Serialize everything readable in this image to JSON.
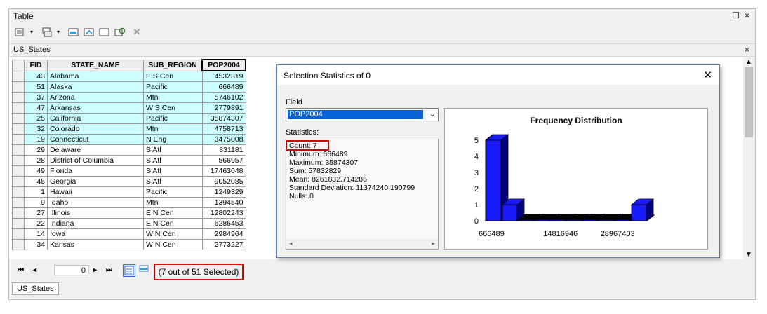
{
  "window": {
    "title": "Table",
    "restore_glyph": "☐",
    "close_glyph": "×"
  },
  "toolbar": {
    "icons": [
      "table-options-icon",
      "related-tables-icon",
      "select-by-attributes-icon",
      "switch-selection-icon",
      "clear-selection-icon",
      "zoom-to-selected-icon",
      "delete-selected-icon"
    ]
  },
  "table_tab_title": "US_States",
  "table": {
    "headers": [
      "FID",
      "STATE_NAME",
      "SUB_REGION",
      "POP2004"
    ],
    "rows": [
      {
        "fid": "43",
        "state": "Alabama",
        "region": "E S Cen",
        "pop": "4532319",
        "selected": true
      },
      {
        "fid": "51",
        "state": "Alaska",
        "region": "Pacific",
        "pop": "666489",
        "selected": true
      },
      {
        "fid": "37",
        "state": "Arizona",
        "region": "Mtn",
        "pop": "5746102",
        "selected": true
      },
      {
        "fid": "47",
        "state": "Arkansas",
        "region": "W S Cen",
        "pop": "2779891",
        "selected": true
      },
      {
        "fid": "25",
        "state": "California",
        "region": "Pacific",
        "pop": "35874307",
        "selected": true
      },
      {
        "fid": "32",
        "state": "Colorado",
        "region": "Mtn",
        "pop": "4758713",
        "selected": true
      },
      {
        "fid": "19",
        "state": "Connecticut",
        "region": "N Eng",
        "pop": "3475008",
        "selected": true
      },
      {
        "fid": "29",
        "state": "Delaware",
        "region": "S Atl",
        "pop": "831181",
        "selected": false
      },
      {
        "fid": "28",
        "state": "District of Columbia",
        "region": "S Atl",
        "pop": "566957",
        "selected": false
      },
      {
        "fid": "49",
        "state": "Florida",
        "region": "S Atl",
        "pop": "17463048",
        "selected": false
      },
      {
        "fid": "45",
        "state": "Georgia",
        "region": "S Atl",
        "pop": "9052085",
        "selected": false
      },
      {
        "fid": "1",
        "state": "Hawaii",
        "region": "Pacific",
        "pop": "1249329",
        "selected": false
      },
      {
        "fid": "9",
        "state": "Idaho",
        "region": "Mtn",
        "pop": "1394540",
        "selected": false
      },
      {
        "fid": "27",
        "state": "Illinois",
        "region": "E N Cen",
        "pop": "12802243",
        "selected": false
      },
      {
        "fid": "22",
        "state": "Indiana",
        "region": "E N Cen",
        "pop": "6286453",
        "selected": false
      },
      {
        "fid": "14",
        "state": "Iowa",
        "region": "W N Cen",
        "pop": "2984964",
        "selected": false
      },
      {
        "fid": "34",
        "state": "Kansas",
        "region": "W N Cen",
        "pop": "2773227",
        "selected": false
      }
    ]
  },
  "nav": {
    "first": "⏮",
    "prev": "◂",
    "record": "0",
    "next": "▸",
    "last": "⏭",
    "selection_status": "(7 out of 51 Selected)"
  },
  "bottom_tab": "US_States",
  "dialog": {
    "title": "Selection Statistics of 0",
    "field_label": "Field",
    "field_value": "POP2004",
    "statistics_label": "Statistics:",
    "stats": {
      "count": "Count:     7",
      "minimum": "Minimum:  666489",
      "maximum": "Maximum: 35874307",
      "sum": "Sum:       57832829",
      "mean": "Mean:      8261832.714286",
      "stddev": "Standard Deviation: 11374240.190799",
      "nulls": "Nulls:      0"
    }
  },
  "chart_data": {
    "type": "bar",
    "title": "Frequency Distribution",
    "values": [
      5,
      1,
      0,
      0,
      0,
      0,
      0,
      0,
      0,
      1
    ],
    "x_tick_labels": [
      "666489",
      "14816946",
      "28967403"
    ],
    "y_ticks": [
      "0",
      "1",
      "2",
      "3",
      "4",
      "5"
    ],
    "ylim": [
      0,
      5
    ],
    "bar_color": "#1a1aff",
    "bar_dark": "#000080"
  }
}
